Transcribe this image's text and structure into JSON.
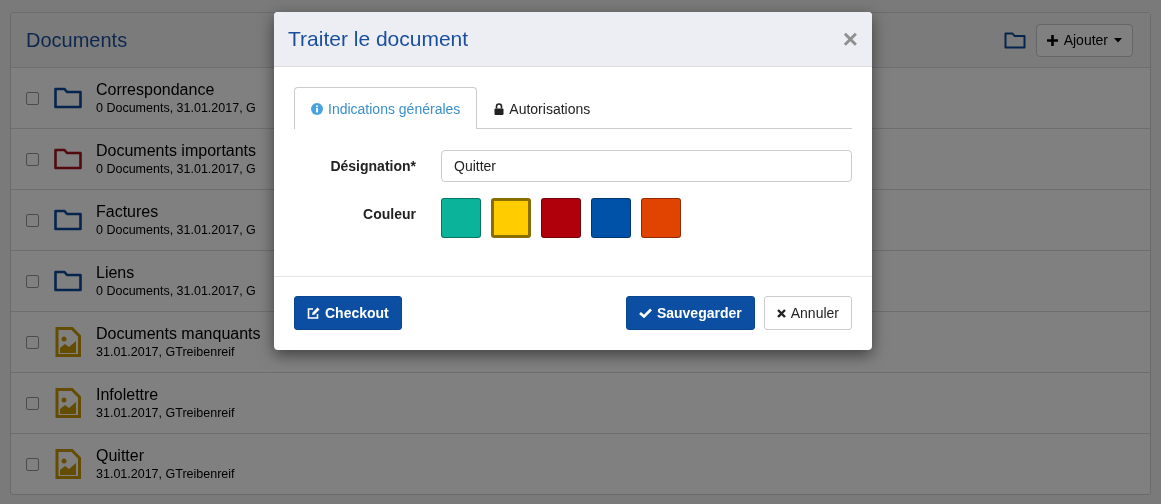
{
  "panel": {
    "title": "Documents",
    "add_button": "Ajouter"
  },
  "rows": [
    {
      "kind": "folder",
      "color": "#05254e",
      "title": "Correspondance",
      "meta": "0 Documents, 31.01.2017, G",
      "checked": false
    },
    {
      "kind": "folder",
      "color": "#520a0e",
      "title": "Documents importants",
      "meta": "0 Documents, 31.01.2017, G",
      "checked": false
    },
    {
      "kind": "folder",
      "color": "#05254e",
      "title": "Factures",
      "meta": "0 Documents, 31.01.2017, G",
      "checked": false
    },
    {
      "kind": "folder",
      "color": "#05254e",
      "title": "Liens",
      "meta": "0 Documents, 31.01.2017, G",
      "checked": false
    },
    {
      "kind": "image",
      "color": "#644d00",
      "title": "Documents manquants",
      "meta": "31.01.2017, GTreibenreif",
      "checked": false
    },
    {
      "kind": "image",
      "color": "#644d00",
      "title": "Infolettre",
      "meta": "31.01.2017, GTreibenreif",
      "checked": false
    },
    {
      "kind": "image",
      "color": "#644d00",
      "title": "Quitter",
      "meta": "31.01.2017, GTreibenreif",
      "checked": false
    }
  ],
  "dialog": {
    "title": "Traiter le document",
    "close": "×",
    "tabs": [
      {
        "kind": "info",
        "label": "Indications générales",
        "selected": true
      },
      {
        "kind": "lock",
        "label": "Autorisations",
        "selected": false
      }
    ],
    "name_label": "Désignation*",
    "name_value": "Quitter",
    "color_label": "Couleur",
    "swatches": [
      {
        "color": "#0bb39a",
        "selected": false
      },
      {
        "color": "#ffcc00",
        "selected": true
      },
      {
        "color": "#b0000c",
        "selected": false
      },
      {
        "color": "#0052a8",
        "selected": false
      },
      {
        "color": "#e04400",
        "selected": false
      }
    ],
    "checkout_button": "Checkout",
    "save_button": "Sauvegarder",
    "cancel_button": "Annuler"
  }
}
